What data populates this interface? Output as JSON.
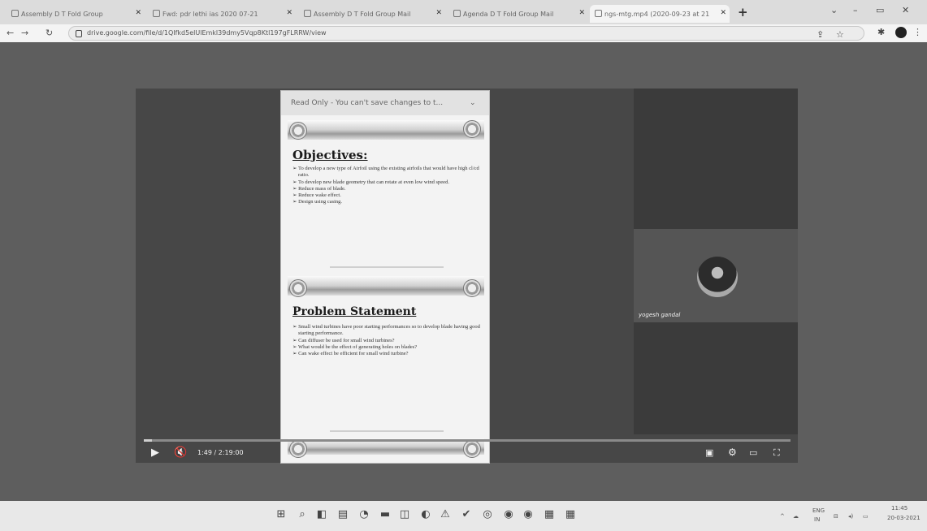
{
  "browser": {
    "tabs": [
      {
        "label": "Assembly D T Fold Group"
      },
      {
        "label": "Fwd: pdr lethi ias 2020 07-21"
      },
      {
        "label": "Assembly D T Fold Group Mail"
      },
      {
        "label": "Agenda D T Fold Group Mail"
      },
      {
        "label": "ngs-mtg.mp4 (2020-09-23 at 21"
      }
    ],
    "new_tab": "+",
    "url": "drive.google.com/file/d/1QIfkd5elUlEmkl39dmy5Vqp8Ktl197gFLRRW/view"
  },
  "document": {
    "toolbar_text": "Read Only - You can't save changes to t...",
    "slide1": {
      "title": "Objectives:",
      "bullets": [
        "➢ To develop a new type of Airfoil using the existing airfoils that would have high cl/cd ratio.",
        "➢ To develop new blade geometry that can rotate at even low wind speed.",
        "➢ Reduce mass of blade.",
        "➢ Reduce wake effect.",
        "➢ Design using casing."
      ]
    },
    "slide2": {
      "title": "Problem Statement",
      "bullets": [
        "➢ Small wind turbines have poor starting performances so to develop blade having good starting performance.",
        "➢ Can diffuser be used for small wind turbines?",
        "➢ What would be the effect of generating holes on blades?",
        "➢ Can wake effect be efficient for small wind turbine?"
      ]
    }
  },
  "participant": {
    "name": "yogesh gandal"
  },
  "player": {
    "time": "1:49 / 2:19:00",
    "progress_fraction": 0.013
  },
  "taskbar": {
    "lang_top": "ENG",
    "lang_bottom": "IN",
    "clock_time": "11:45",
    "clock_date": "20-03-2021"
  }
}
